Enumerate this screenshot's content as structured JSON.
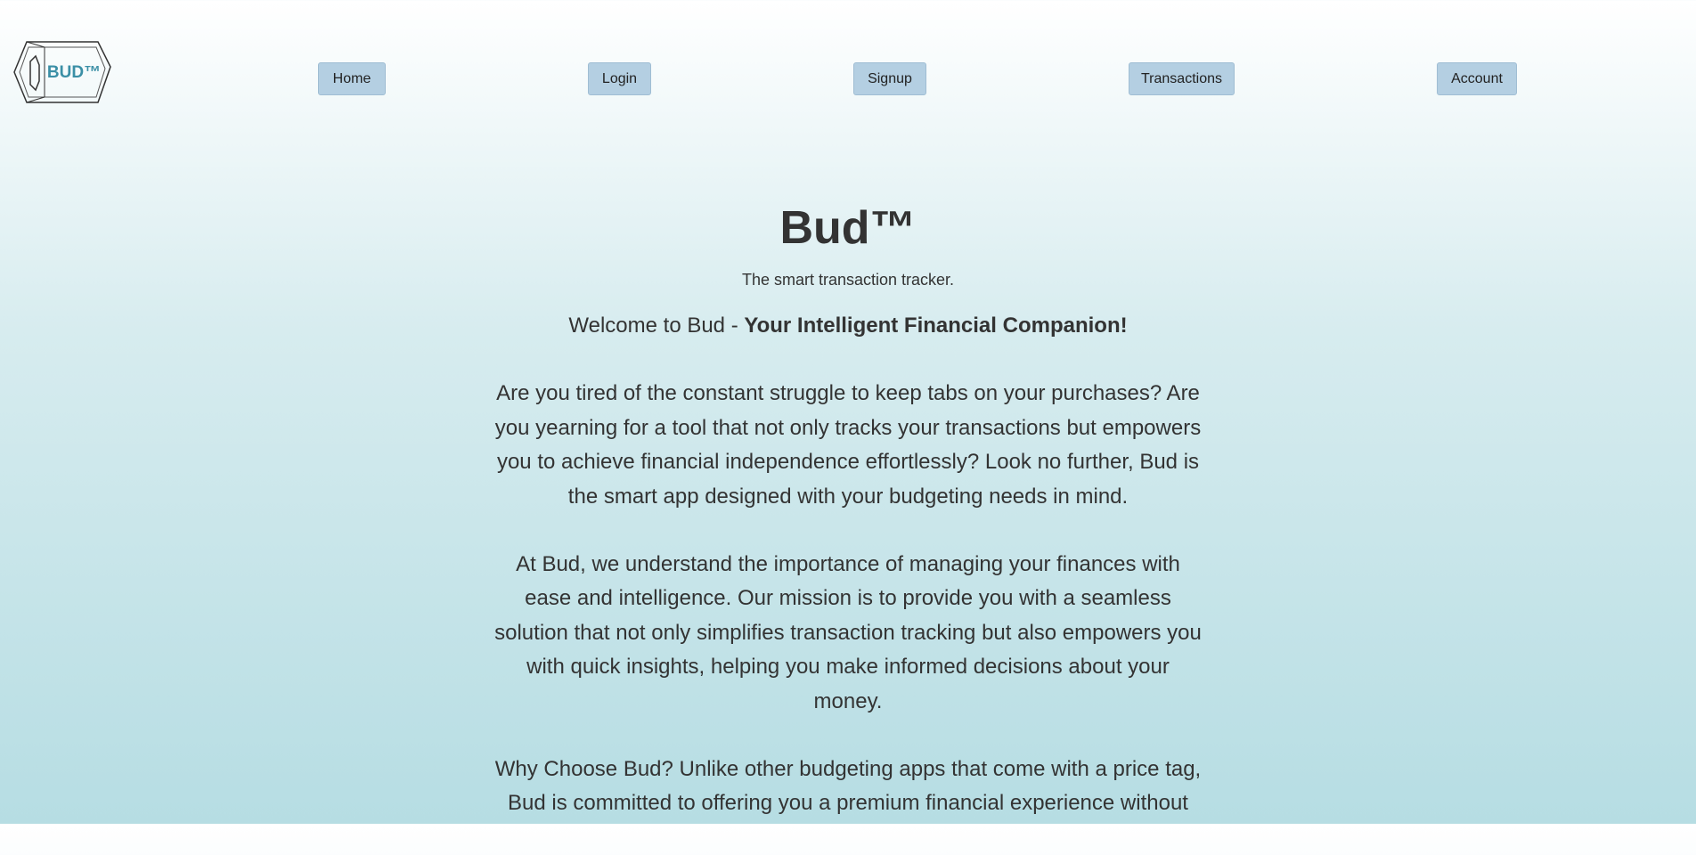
{
  "logo": {
    "text": "BUD™",
    "accent": "#3b8fa6"
  },
  "nav": {
    "home": "Home",
    "login": "Login",
    "signup": "Signup",
    "transactions": "Transactions",
    "account": "Account"
  },
  "hero": {
    "title": "Bud™",
    "subtitle": "The smart transaction tracker."
  },
  "content": {
    "welcome_prefix": "Welcome to Bud - ",
    "welcome_bold": "Your Intelligent Financial Companion!",
    "paragraph1": "Are you tired of the constant struggle to keep tabs on your purchases? Are you yearning for a tool that not only tracks your transactions but empowers you to achieve financial independence effortlessly? Look no further, Bud is the smart app designed with your budgeting needs in mind.",
    "paragraph2": "At Bud, we understand the importance of managing your finances with ease and intelligence. Our mission is to provide you with a seamless solution that not only simplifies transaction tracking but also empowers you with quick insights, helping you make informed decisions about your money.",
    "paragraph3": "Why Choose Bud? Unlike other budgeting apps that come with a price tag, Bud is committed to offering you a premium financial experience without"
  }
}
